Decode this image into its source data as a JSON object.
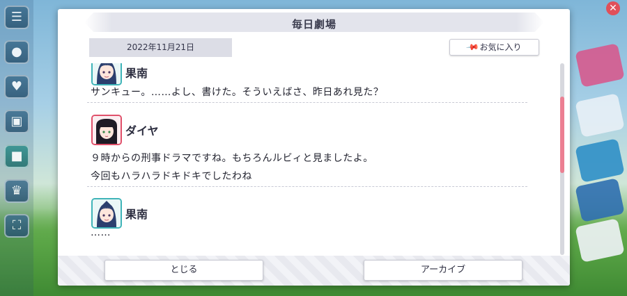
{
  "dialog": {
    "title": "毎日劇場",
    "date": "2022年11月21日",
    "favorite_label": "お気に入り",
    "favorite_icon": "pin-icon",
    "close_label": "とじる",
    "archive_label": "アーカイブ"
  },
  "messages": [
    {
      "speaker": "果南",
      "avatar_color": "#3fb4b8",
      "lines": [
        "サンキュー。……よし、書けた。そういえばさ、昨日あれ見た？"
      ]
    },
    {
      "speaker": "ダイヤ",
      "avatar_color": "#e0506a",
      "lines": [
        "９時からの刑事ドラマですね。もちろんルビィと見ましたよ。",
        "今回もハラハラドキドキでしたわね"
      ]
    },
    {
      "speaker": "果南",
      "avatar_color": "#3fb4b8",
      "lines": [
        "……"
      ]
    }
  ],
  "colors": {
    "scroll_thumb": "#ec7f92",
    "accent_teal": "#3fb4b8",
    "accent_pink": "#e0506a"
  }
}
